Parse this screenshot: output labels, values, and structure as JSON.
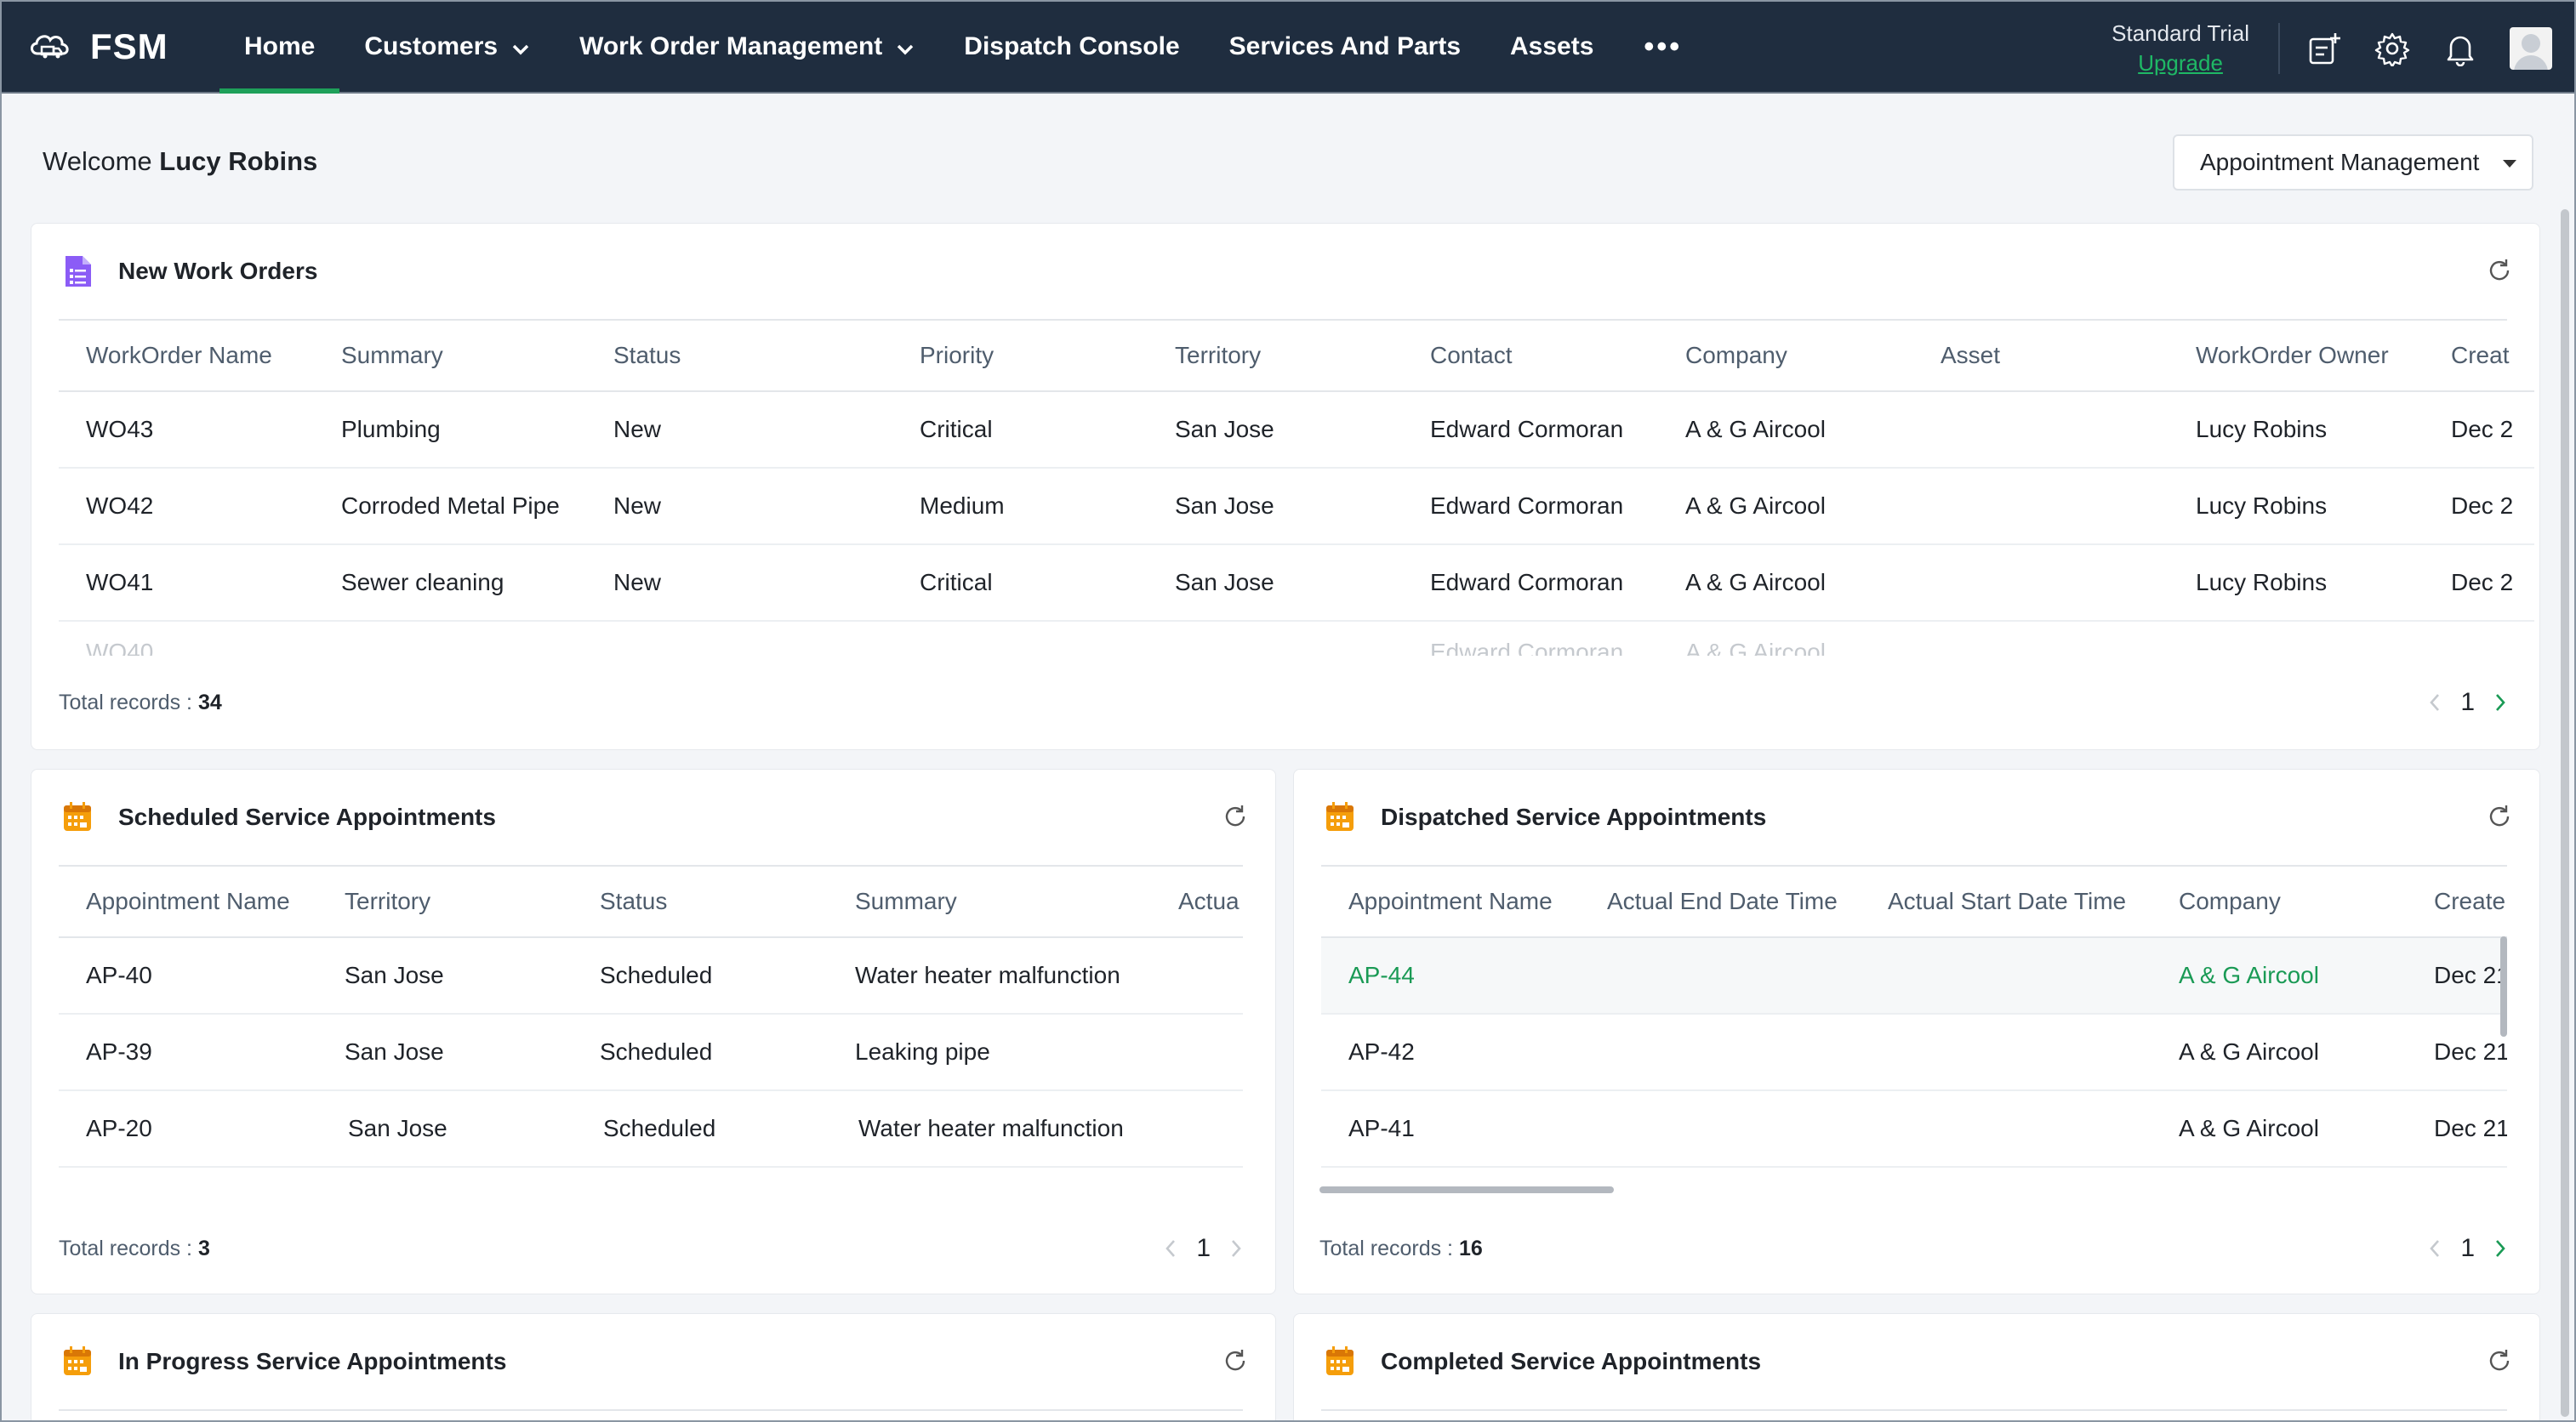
{
  "app": {
    "name": "FSM"
  },
  "nav": {
    "items": [
      {
        "label": "Home",
        "active": true,
        "dropdown": false
      },
      {
        "label": "Customers",
        "active": false,
        "dropdown": true
      },
      {
        "label": "Work Order Management",
        "active": false,
        "dropdown": true
      },
      {
        "label": "Dispatch Console",
        "active": false,
        "dropdown": false
      },
      {
        "label": "Services And Parts",
        "active": false,
        "dropdown": false
      },
      {
        "label": "Assets",
        "active": false,
        "dropdown": false
      }
    ],
    "more": "•••"
  },
  "account": {
    "plan": "Standard Trial",
    "upgrade": "Upgrade"
  },
  "icons": {
    "logo": "cloud-truck-icon",
    "quick_create": "note-add-icon",
    "settings": "gear-icon",
    "notifications": "bell-icon",
    "avatar": "user-avatar",
    "refresh": "refresh-icon",
    "work_orders": "document-list-icon",
    "appointments": "calendar-icon"
  },
  "colors": {
    "nav_bg": "#1f2d3f",
    "accent": "#1ea05a",
    "link_green": "#1a9a55",
    "wo_icon": "#8b5cf6",
    "appt_icon": "#f59e0b"
  },
  "welcome": {
    "prefix": "Welcome",
    "user": "Lucy Robins"
  },
  "dashboard_select": {
    "value": "Appointment Management"
  },
  "new_work_orders": {
    "title": "New Work Orders",
    "columns": [
      "WorkOrder Name",
      "Summary",
      "Status",
      "Priority",
      "Territory",
      "Contact",
      "Company",
      "Asset",
      "WorkOrder Owner",
      "Creat"
    ],
    "rows": [
      [
        "WO43",
        "Plumbing",
        "New",
        "Critical",
        "San Jose",
        "Edward Cormoran",
        "A & G Aircool",
        "",
        "Lucy Robins",
        "Dec 2"
      ],
      [
        "WO42",
        "Corroded Metal Pipe",
        "New",
        "Medium",
        "San Jose",
        "Edward Cormoran",
        "A & G Aircool",
        "",
        "Lucy Robins",
        "Dec 2"
      ],
      [
        "WO41",
        "Sewer cleaning",
        "New",
        "Critical",
        "San Jose",
        "Edward Cormoran",
        "A & G Aircool",
        "",
        "Lucy Robins",
        "Dec 2"
      ]
    ],
    "ghost_row": [
      "WO40",
      "",
      "",
      "",
      "",
      "Edward Cormoran",
      "A & G Aircool",
      "",
      "",
      ""
    ],
    "total_label": "Total records :",
    "total": "34",
    "page": "1"
  },
  "scheduled": {
    "title": "Scheduled Service Appointments",
    "columns": [
      "Appointment Name",
      "Territory",
      "Status",
      "Summary",
      "Actua"
    ],
    "rows": [
      [
        "AP-40",
        "San Jose",
        "Scheduled",
        "Water heater malfunction",
        ""
      ],
      [
        "AP-39",
        "San Jose",
        "Scheduled",
        "Leaking pipe",
        ""
      ],
      [
        "AP-20",
        "San Jose",
        "Scheduled",
        "Water heater malfunction",
        ""
      ]
    ],
    "total_label": "Total records :",
    "total": "3",
    "page": "1"
  },
  "dispatched": {
    "title": "Dispatched Service Appointments",
    "columns": [
      "Appointment Name",
      "Actual End Date Time",
      "Actual Start Date Time",
      "Company",
      "Create"
    ],
    "rows": [
      [
        "AP-44",
        "",
        "",
        "A & G Aircool",
        "Dec 21"
      ],
      [
        "AP-42",
        "",
        "",
        "A & G Aircool",
        "Dec 21"
      ],
      [
        "AP-41",
        "",
        "",
        "A & G Aircool",
        "Dec 21"
      ]
    ],
    "selected_row": 0,
    "total_label": "Total records :",
    "total": "16",
    "page": "1"
  },
  "in_progress": {
    "title": "In Progress Service Appointments"
  },
  "completed": {
    "title": "Completed Service Appointments"
  }
}
